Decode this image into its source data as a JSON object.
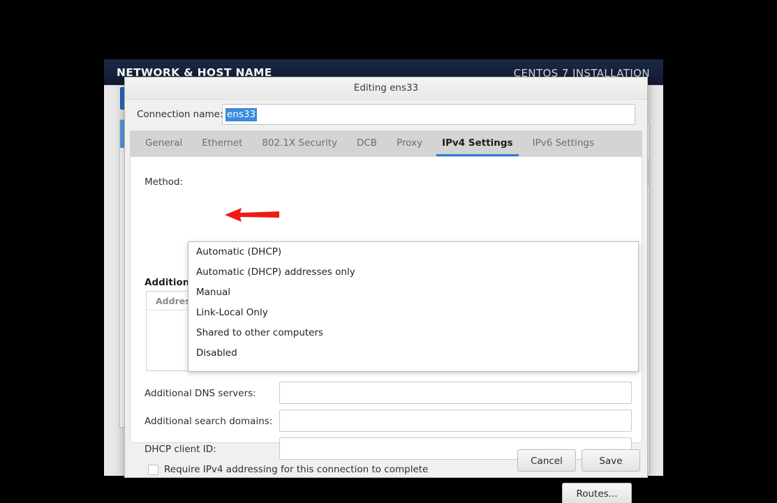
{
  "installer": {
    "header_title": "NETWORK & HOST NAME",
    "header_right": "CENTOS 7 INSTALLATION",
    "footer_note": ""
  },
  "dialog": {
    "title": "Editing ens33",
    "connection_label": "Connection name:",
    "connection_value": "ens33",
    "tabs": [
      {
        "label": "General",
        "active": false
      },
      {
        "label": "Ethernet",
        "active": false
      },
      {
        "label": "802.1X Security",
        "active": false
      },
      {
        "label": "DCB",
        "active": false
      },
      {
        "label": "Proxy",
        "active": false
      },
      {
        "label": "IPv4 Settings",
        "active": true
      },
      {
        "label": "IPv6 Settings",
        "active": false
      }
    ],
    "method_label": "Method:",
    "additional_label": "Additional",
    "address_column": "Addres",
    "method_options": [
      "Automatic (DHCP)",
      "Automatic (DHCP) addresses only",
      "Manual",
      "Link-Local Only",
      "Shared to other computers",
      "Disabled"
    ],
    "fields": [
      {
        "label": "Additional DNS servers:",
        "value": "",
        "placeholder": ""
      },
      {
        "label": "Additional search domains:",
        "value": "",
        "placeholder": ""
      },
      {
        "label": "DHCP client ID:",
        "value": "",
        "placeholder": ""
      }
    ],
    "require_ipv4_label": "Require IPv4 addressing for this connection to complete",
    "require_ipv4_checked": false,
    "routes_label": "Routes...",
    "cancel_label": "Cancel",
    "save_label": "Save"
  },
  "annotation": {
    "arrow_color": "#ee1c16",
    "points_at": "Manual"
  },
  "colors": {
    "accent_blue": "#2a7ad4",
    "selection_blue": "#3c8add",
    "header_navy": "#16213a",
    "dialog_bg": "#f0f0ef",
    "tabstrip_bg": "#d4d4d2"
  }
}
